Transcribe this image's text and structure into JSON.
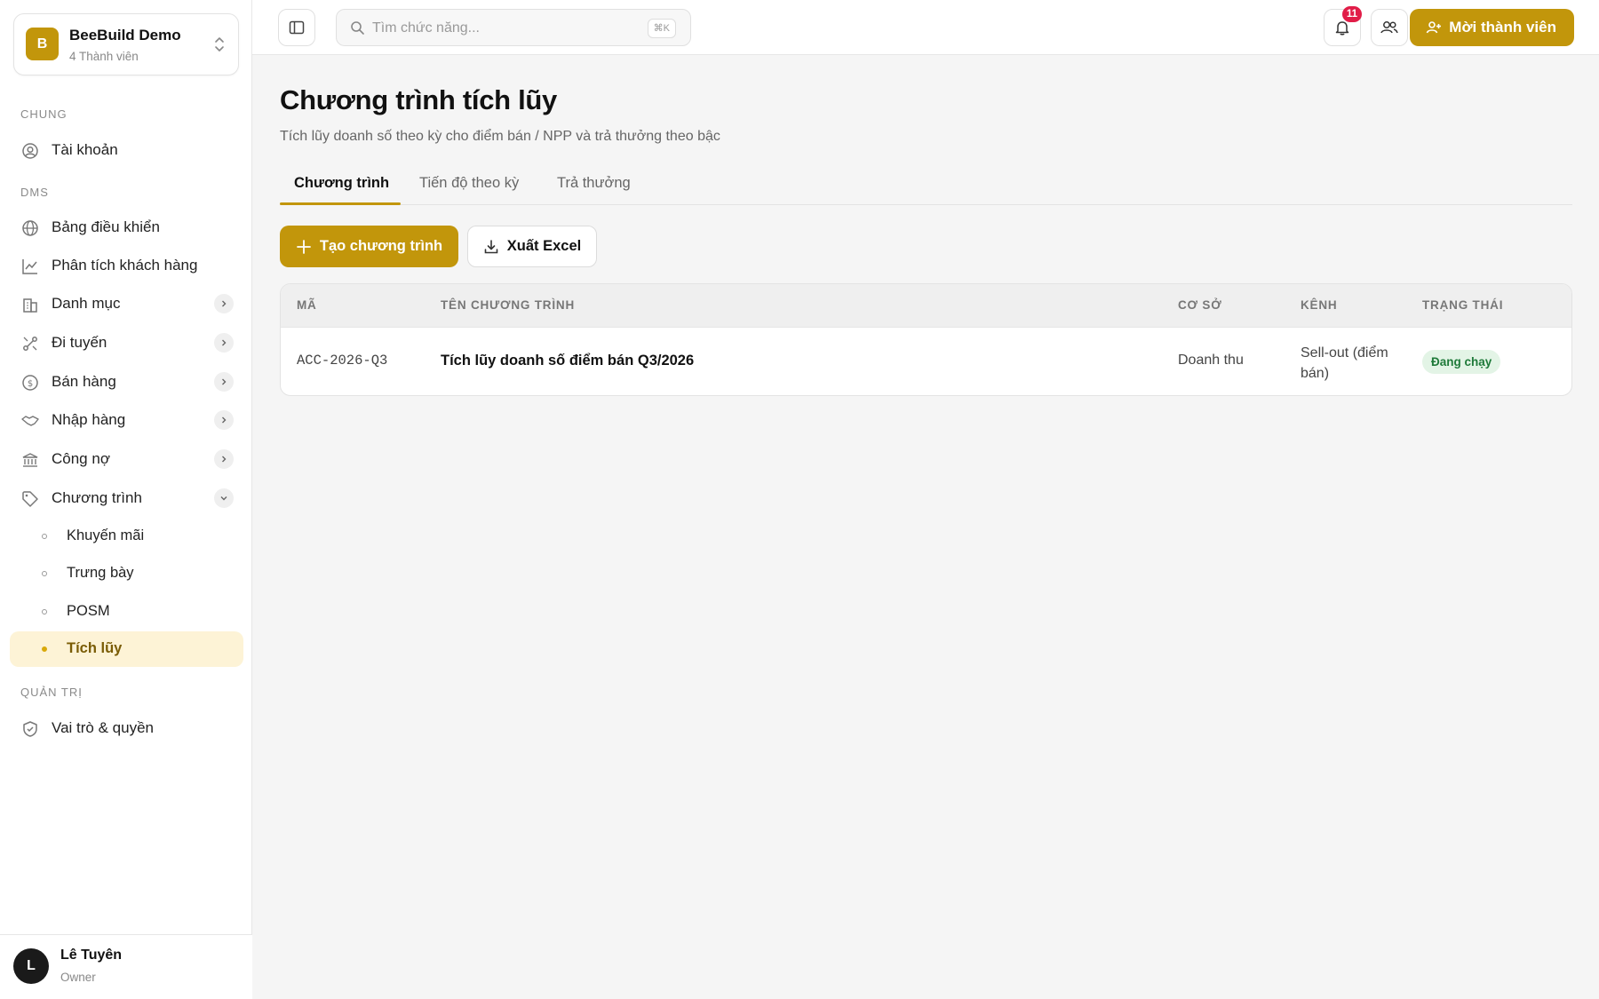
{
  "workspace": {
    "logo_letter": "B",
    "name": "BeeBuild Demo",
    "members": "4 Thành viên"
  },
  "sidebar": {
    "sections": [
      {
        "label": "CHUNG"
      },
      {
        "label": "DMS"
      },
      {
        "label": "QUẢN TRỊ"
      }
    ],
    "items": [
      {
        "label": "Tài khoản",
        "icon": "user-circle-icon"
      },
      {
        "label": "Bảng điều khiển",
        "icon": "globe-icon"
      },
      {
        "label": "Phân tích khách hàng",
        "icon": "chart-line-icon"
      },
      {
        "label": "Danh mục",
        "icon": "building-icon"
      },
      {
        "label": "Đi tuyến",
        "icon": "route-icon"
      },
      {
        "label": "Bán hàng",
        "icon": "dollar-icon"
      },
      {
        "label": "Nhập hàng",
        "icon": "handshake-icon"
      },
      {
        "label": "Công nợ",
        "icon": "bank-icon"
      },
      {
        "label": "Chương trình",
        "icon": "tag-icon"
      },
      {
        "label": "Vai trò & quyền",
        "icon": "shield-icon"
      }
    ],
    "subitems": [
      {
        "label": "Khuyến mãi"
      },
      {
        "label": "Trưng bày"
      },
      {
        "label": "POSM"
      },
      {
        "label": "Tích lũy"
      }
    ]
  },
  "user": {
    "initial": "L",
    "name": "Lê Tuyên",
    "role": "Owner"
  },
  "topbar": {
    "search_placeholder": "Tìm chức năng...",
    "shortcut": "⌘K",
    "notification_count": "11",
    "invite_label": "Mời thành viên"
  },
  "page": {
    "title": "Chương trình tích lũy",
    "description": "Tích lũy doanh số theo kỳ cho điểm bán / NPP và trả thưởng theo bậc"
  },
  "tabs": [
    {
      "label": "Chương trình"
    },
    {
      "label": "Tiến độ theo kỳ"
    },
    {
      "label": "Trả thưởng"
    }
  ],
  "toolbar": {
    "create_label": "Tạo chương trình",
    "export_label": "Xuất Excel"
  },
  "table": {
    "headers": [
      "MÃ",
      "TÊN CHƯƠNG TRÌNH",
      "CƠ SỞ",
      "KÊNH",
      "TRẠNG THÁI"
    ],
    "rows": [
      {
        "code": "ACC-2026-Q3",
        "name": "Tích lũy doanh số điểm bán Q3/2026",
        "basis": "Doanh thu",
        "channel_line1": "Sell-out (điểm",
        "channel_line2": "bán)",
        "status": "Đang chạy"
      }
    ]
  },
  "colors": {
    "accent": "#c2960b",
    "badge": "#e11d48",
    "status_bg": "#e3f4e6",
    "status_text": "#1f7a3a"
  }
}
